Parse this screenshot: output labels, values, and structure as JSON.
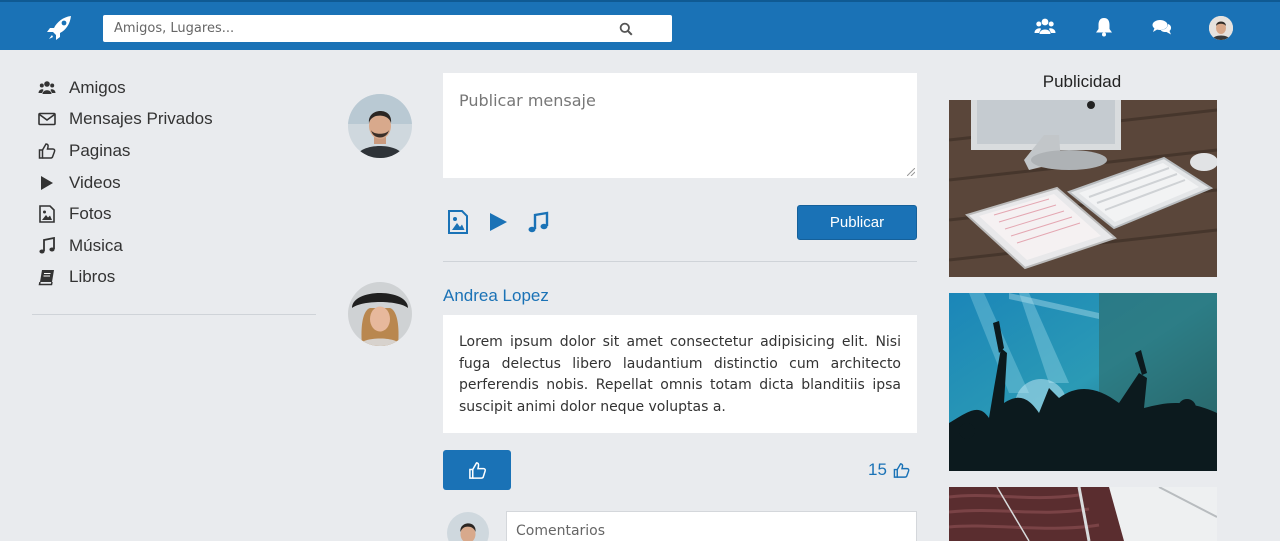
{
  "header": {
    "search_placeholder": "Amigos, Lugares...",
    "icons": [
      "rocket-icon",
      "search-icon",
      "friends-icon",
      "bell-icon",
      "chat-icon",
      "avatar"
    ],
    "colors": {
      "bar": "#1a72b6",
      "accent": "#1a72b6",
      "background": "#e9ebee"
    }
  },
  "sidebar": {
    "items": [
      {
        "label": "Amigos",
        "icon": "users-icon"
      },
      {
        "label": "Mensajes Privados",
        "icon": "envelope-icon"
      },
      {
        "label": "Paginas",
        "icon": "thumbs-up-icon"
      },
      {
        "label": "Videos",
        "icon": "play-icon"
      },
      {
        "label": "Fotos",
        "icon": "image-icon"
      },
      {
        "label": "Música",
        "icon": "music-icon"
      },
      {
        "label": "Libros",
        "icon": "book-icon"
      }
    ]
  },
  "composer": {
    "placeholder": "Publicar mensaje",
    "media_icons": [
      "image-icon",
      "video-icon",
      "music-icon"
    ],
    "publish_label": "Publicar"
  },
  "post": {
    "author": "Andrea Lopez",
    "text": "Lorem ipsum dolor sit amet consectetur adipisicing elit. Nisi fuga delectus libero laudantium distinctio cum architecto perferendis nobis. Repellat omnis totam dicta blanditiis ipsa suscipit animi dolor neque voluptas a.",
    "like_count": "15",
    "comment_placeholder": "Comentarios"
  },
  "ads": {
    "title": "Publicidad",
    "images": [
      "desk-computer-tablet-keyboard-photo",
      "concert-crowd-photo",
      "sailboat-sea-photo"
    ]
  }
}
